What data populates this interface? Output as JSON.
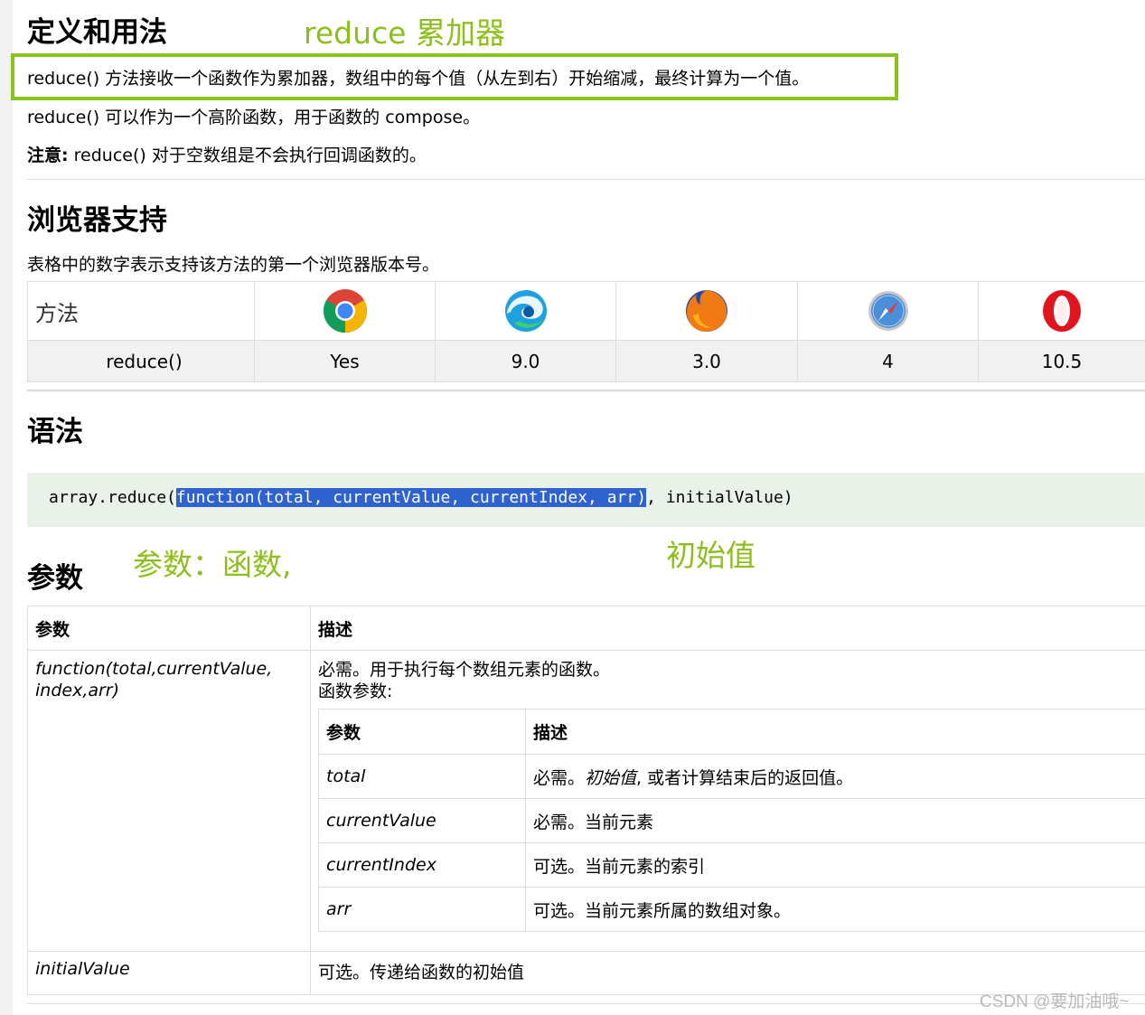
{
  "definition": {
    "heading": "定义和用法",
    "annotation": "reduce 累加器",
    "line1": "reduce() 方法接收一个函数作为累加器，数组中的每个值（从左到右）开始缩减，最终计算为一个值。",
    "line2": "reduce() 可以作为一个高阶函数，用于函数的 compose。",
    "note_label": "注意:",
    "note_text": " reduce() 对于空数组是不会执行回调函数的。"
  },
  "browser_support": {
    "heading": "浏览器支持",
    "desc": "表格中的数字表示支持该方法的第一个浏览器版本号。",
    "method_header": "方法",
    "browsers": [
      "chrome-icon",
      "edge-icon",
      "firefox-icon",
      "safari-icon",
      "opera-icon"
    ],
    "method": "reduce()",
    "versions": [
      "Yes",
      "9.0",
      "3.0",
      "4",
      "10.5"
    ]
  },
  "syntax": {
    "heading": "语法",
    "code_before": "array.reduce(",
    "code_selected": "function(total, currentValue, currentIndex, arr)",
    "code_after": ", initialValue)"
  },
  "params": {
    "heading": "参数",
    "annotation1": "参数：函数,",
    "annotation2": "初始值",
    "col_param": "参数",
    "col_desc": "描述",
    "row1_param": "function(total,currentValue, index,arr)",
    "row1_desc1": "必需。用于执行每个数组元素的函数。",
    "row1_desc2": "函数参数:",
    "inner_col_param": "参数",
    "inner_col_desc": "描述",
    "inner_rows": [
      {
        "param": "total",
        "desc_prefix": "必需。",
        "desc_ital": "初始值",
        "desc_suffix": ", 或者计算结束后的返回值。"
      },
      {
        "param": "currentValue",
        "desc_prefix": "必需。当前元素",
        "desc_ital": "",
        "desc_suffix": ""
      },
      {
        "param": "currentIndex",
        "desc_prefix": "可选。当前元素的索引",
        "desc_ital": "",
        "desc_suffix": ""
      },
      {
        "param": "arr",
        "desc_prefix": "可选。当前元素所属的数组对象。",
        "desc_ital": "",
        "desc_suffix": ""
      }
    ],
    "row2_param": "initialValue",
    "row2_desc": "可选。传递给函数的初始值"
  },
  "watermark": "CSDN @要加油哦~",
  "colors": {
    "annotation_green": "#8cbf1c",
    "selection_blue": "#2e62cf",
    "code_bg": "#e8f2e8"
  }
}
